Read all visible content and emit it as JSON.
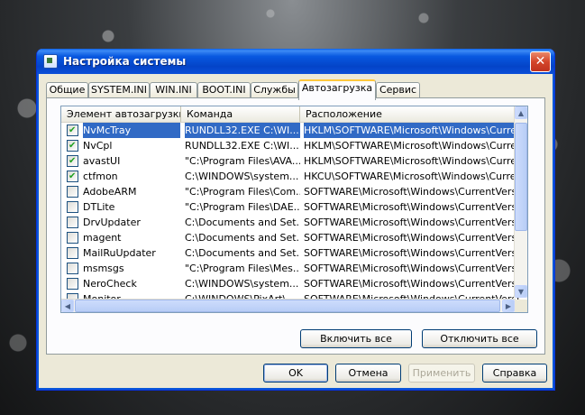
{
  "window": {
    "title": "Настройка системы",
    "close_glyph": "✕"
  },
  "tabs": [
    {
      "label": "Общие",
      "active": false
    },
    {
      "label": "SYSTEM.INI",
      "active": false
    },
    {
      "label": "WIN.INI",
      "active": false
    },
    {
      "label": "BOOT.INI",
      "active": false
    },
    {
      "label": "Службы",
      "active": false
    },
    {
      "label": "Автозагрузка",
      "active": true
    },
    {
      "label": "Сервис",
      "active": false
    }
  ],
  "list": {
    "columns": [
      "Элемент автозагрузки",
      "Команда",
      "Расположение"
    ],
    "rows": [
      {
        "name": "NvMcTray",
        "command": "RUNDLL32.EXE C:\\WI...",
        "location": "HKLM\\SOFTWARE\\Microsoft\\Windows\\CurrentVer...",
        "checked": true,
        "selected": true
      },
      {
        "name": "NvCpl",
        "command": "RUNDLL32.EXE C:\\WI...",
        "location": "HKLM\\SOFTWARE\\Microsoft\\Windows\\CurrentVer...",
        "checked": true,
        "selected": false
      },
      {
        "name": "avastUI",
        "command": "\"C:\\Program Files\\AVA...",
        "location": "HKLM\\SOFTWARE\\Microsoft\\Windows\\CurrentVer...",
        "checked": true,
        "selected": false
      },
      {
        "name": "ctfmon",
        "command": "C:\\WINDOWS\\system...",
        "location": "HKCU\\SOFTWARE\\Microsoft\\Windows\\CurrentVer...",
        "checked": true,
        "selected": false
      },
      {
        "name": "AdobeARM",
        "command": "\"C:\\Program Files\\Com...",
        "location": "SOFTWARE\\Microsoft\\Windows\\CurrentVersion\\Ru...",
        "checked": false,
        "selected": false
      },
      {
        "name": "DTLite",
        "command": "\"C:\\Program Files\\DAE...",
        "location": "SOFTWARE\\Microsoft\\Windows\\CurrentVersion\\Ru...",
        "checked": false,
        "selected": false
      },
      {
        "name": "DrvUpdater",
        "command": "C:\\Documents and Set...",
        "location": "SOFTWARE\\Microsoft\\Windows\\CurrentVersion\\Ru...",
        "checked": false,
        "selected": false
      },
      {
        "name": "magent",
        "command": "C:\\Documents and Set...",
        "location": "SOFTWARE\\Microsoft\\Windows\\CurrentVersion\\Ru...",
        "checked": false,
        "selected": false
      },
      {
        "name": "MailRuUpdater",
        "command": "C:\\Documents and Set...",
        "location": "SOFTWARE\\Microsoft\\Windows\\CurrentVersion\\Ru...",
        "checked": false,
        "selected": false
      },
      {
        "name": "msmsgs",
        "command": "\"C:\\Program Files\\Mes...",
        "location": "SOFTWARE\\Microsoft\\Windows\\CurrentVersion\\Ru...",
        "checked": false,
        "selected": false
      },
      {
        "name": "NeroCheck",
        "command": "C:\\WINDOWS\\system...",
        "location": "SOFTWARE\\Microsoft\\Windows\\CurrentVersion\\Ru...",
        "checked": false,
        "selected": false
      },
      {
        "name": "Monitor",
        "command": "C:\\WINDOWS\\PixArt\\...",
        "location": "SOFTWARE\\Microsoft\\Windows\\CurrentVersion\\Ru...",
        "checked": false,
        "selected": false
      }
    ]
  },
  "panel_buttons": {
    "enable_all": "Включить все",
    "disable_all": "Отключить все"
  },
  "dialog_buttons": {
    "ok": "OK",
    "cancel": "Отмена",
    "apply": "Применить",
    "help": "Справка"
  },
  "icons": {
    "scroll_up": "▲",
    "scroll_down": "▼",
    "scroll_left": "◀",
    "scroll_right": "▶"
  }
}
